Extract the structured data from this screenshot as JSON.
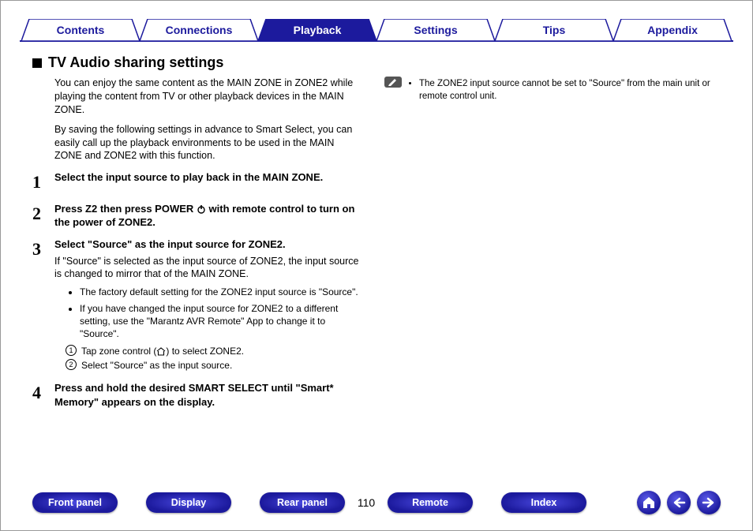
{
  "tabs": {
    "contents": "Contents",
    "connections": "Connections",
    "playback": "Playback",
    "settings": "Settings",
    "tips": "Tips",
    "appendix": "Appendix"
  },
  "section": {
    "title": "TV Audio sharing settings",
    "intro1": "You can enjoy the same content as the MAIN ZONE in ZONE2 while playing the content from TV or other playback devices in the MAIN ZONE.",
    "intro2": "By saving the following settings in advance to Smart Select, you can easily call up the playback environments to be used in the MAIN ZONE and ZONE2 with this function."
  },
  "steps": [
    {
      "num": "1",
      "title": "Select the input source to play back in the MAIN ZONE."
    },
    {
      "num": "2",
      "title_pre": "Press Z2 then press POWER ",
      "title_post": " with remote control to turn on the power of ZONE2."
    },
    {
      "num": "3",
      "title": "Select \"Source\" as the input source for ZONE2.",
      "desc": "If \"Source\" is selected as the input source of ZONE2, the input source is changed to mirror that of the MAIN ZONE.",
      "bullets": [
        "The factory default setting for the ZONE2 input source is \"Source\".",
        "If you have changed the input source for ZONE2 to a different setting, use the \"Marantz AVR Remote\" App to change it to \"Source\"."
      ],
      "sub": [
        "Tap zone control (",
        ") to select ZONE2.",
        "Select \"Source\" as the input source."
      ],
      "subnum1": "1",
      "subnum2": "2"
    },
    {
      "num": "4",
      "title": "Press and hold the desired SMART SELECT until \"Smart* Memory\" appears on the display."
    }
  ],
  "note": "The ZONE2 input source cannot be set to \"Source\" from the main unit or remote control unit.",
  "bottom": {
    "front_panel": "Front panel",
    "display": "Display",
    "rear_panel": "Rear panel",
    "page": "110",
    "remote": "Remote",
    "index": "Index"
  }
}
